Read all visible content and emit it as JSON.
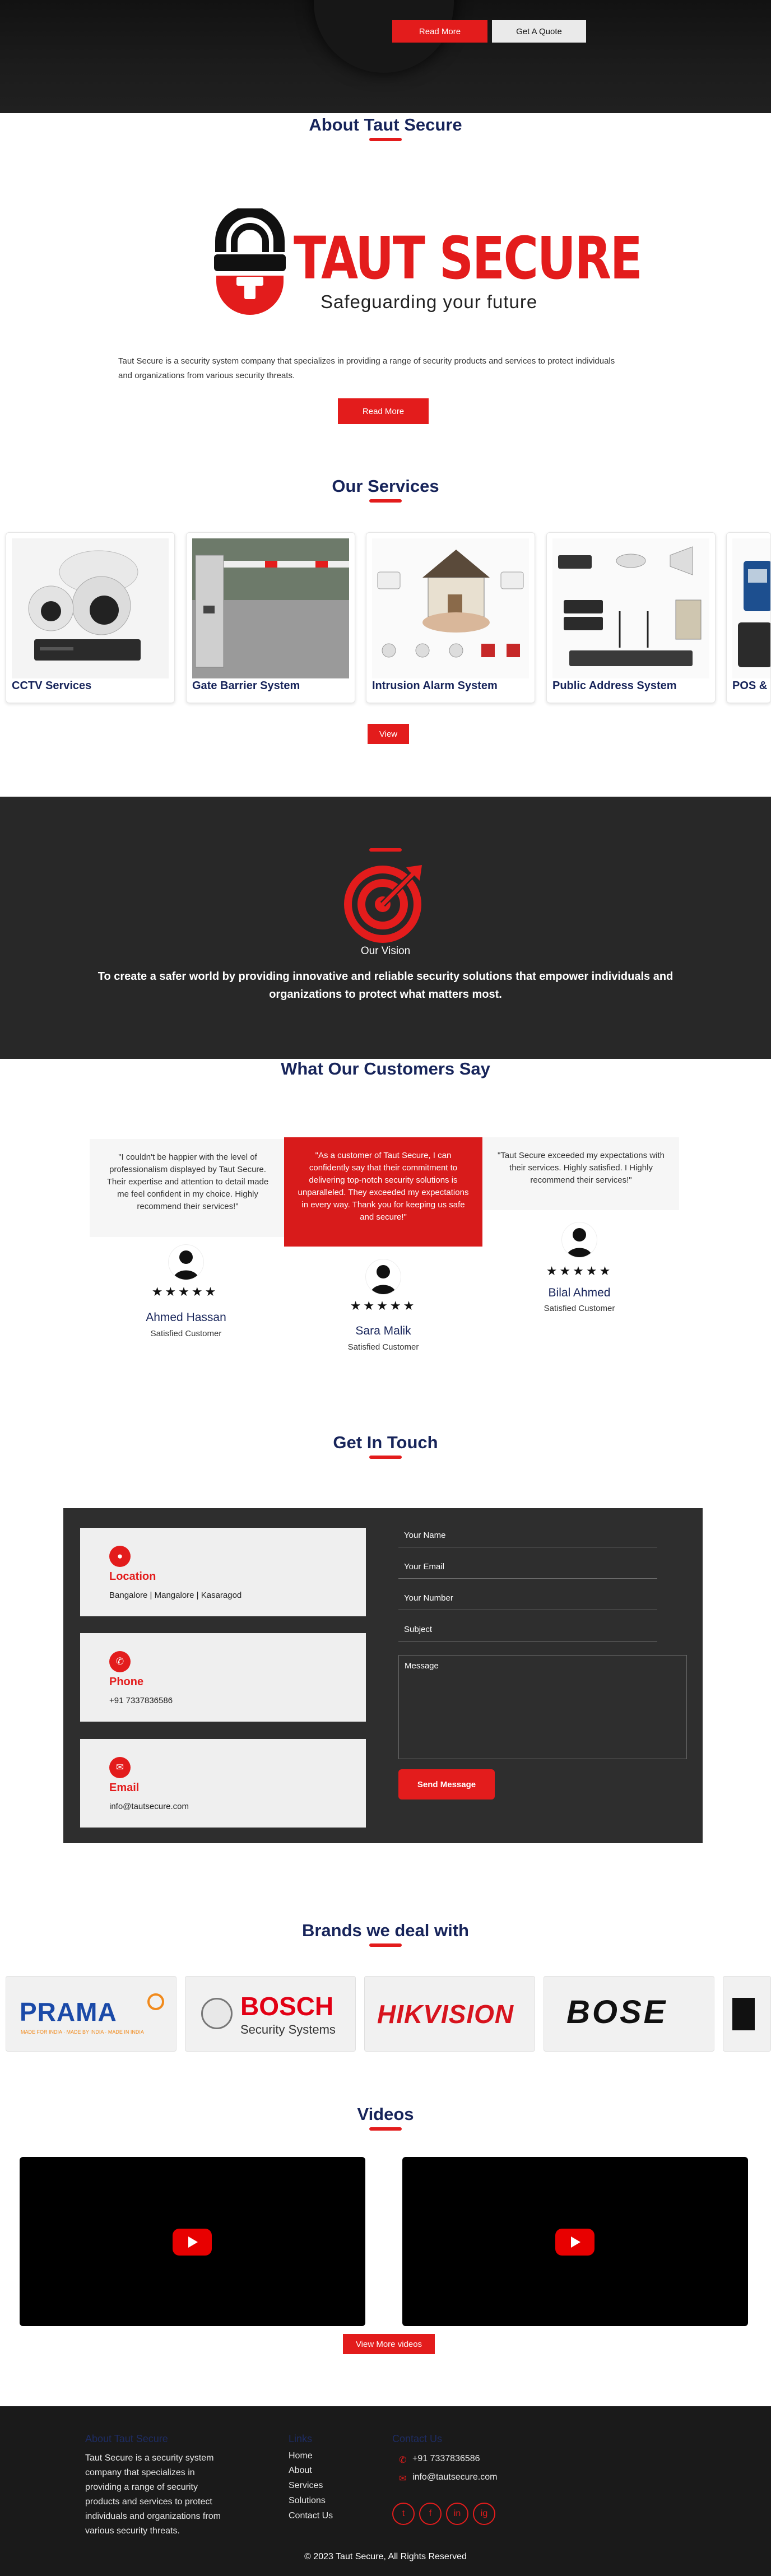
{
  "colors": {
    "accent": "#e31c1c",
    "navy": "#17245a",
    "dark": "#282828"
  },
  "hero": {
    "read_more": "Read More",
    "get_quote": "Get A Quote"
  },
  "about": {
    "title": "About Taut Secure",
    "logo_name": "TAUT SECURE",
    "logo_tagline": "Safeguarding your future",
    "text": "Taut Secure is a security system company that specializes in providing a range of security products and services to protect individuals and organizations from various security threats.",
    "read_more": "Read More"
  },
  "services": {
    "title": "Our Services",
    "items": [
      {
        "label": "CCTV Services"
      },
      {
        "label": "Gate Barrier System"
      },
      {
        "label": "Intrusion Alarm System"
      },
      {
        "label": "Public Address System"
      },
      {
        "label": "POS & Billing"
      }
    ],
    "view": "View"
  },
  "vision": {
    "label": "Our Vision",
    "text": "To create a safer world by providing innovative and reliable security solutions that empower individuals and organizations to protect what matters most."
  },
  "testimonials": {
    "title": "What Our Customers Say",
    "items": [
      {
        "quote": "\"I couldn't be happier with the level of professionalism displayed by Taut Secure. Their expertise and attention to detail made me feel confident in my choice. Highly recommend their services!\"",
        "stars": "★★★★★",
        "name": "Ahmed Hassan",
        "role": "Satisfied Customer"
      },
      {
        "quote": "\"As a customer of Taut Secure, I can confidently say that their commitment to delivering top-notch security solutions is unparalleled. They exceeded my expectations in every way. Thank you for keeping us safe and secure!\"",
        "stars": "★★★★★",
        "name": "Sara Malik",
        "role": "Satisfied Customer"
      },
      {
        "quote": "\"Taut Secure exceeded my expectations with their services. Highly satisfied. I Highly recommend their services!\"",
        "stars": "★★★★★",
        "name": "Bilal Ahmed",
        "role": "Satisfied Customer"
      }
    ]
  },
  "contact": {
    "title": "Get In Touch",
    "cards": [
      {
        "icon": "location-pin-icon",
        "label": "Location",
        "value": "Bangalore | Mangalore | Kasaragod"
      },
      {
        "icon": "phone-icon",
        "label": "Phone",
        "value": "+91 7337836586"
      },
      {
        "icon": "envelope-icon",
        "label": "Email",
        "value": "info@tautsecure.com"
      }
    ],
    "form": {
      "name": "Your Name",
      "email": "Your Email",
      "number": "Your Number",
      "subject": "Subject",
      "message": "Message",
      "send": "Send Message"
    }
  },
  "brands": {
    "title": "Brands we deal with",
    "items": [
      {
        "name": "PRAMA",
        "sub": "MADE FOR INDIA · MADE BY INDIA · MADE IN INDIA"
      },
      {
        "name": "BOSCH",
        "sub": "Security Systems"
      },
      {
        "name": "HIKVISION"
      },
      {
        "name": "BOSE"
      }
    ]
  },
  "videos": {
    "title": "Videos",
    "more": "View More videos"
  },
  "footer": {
    "about_head": "About Taut Secure",
    "about_text": "Taut Secure is a security system company that specializes in providing a range of security products and services to protect individuals and organizations from various security threats.",
    "links_head": "Links",
    "links": [
      "Home",
      "About",
      "Services",
      "Solutions",
      "Contact Us"
    ],
    "contact_head": "Contact Us",
    "phone": "+91 7337836586",
    "email": "info@tautsecure.com",
    "social": [
      "t",
      "f",
      "in",
      "ig"
    ],
    "copyright": "© 2023 Taut Secure, All Rights Reserved"
  }
}
